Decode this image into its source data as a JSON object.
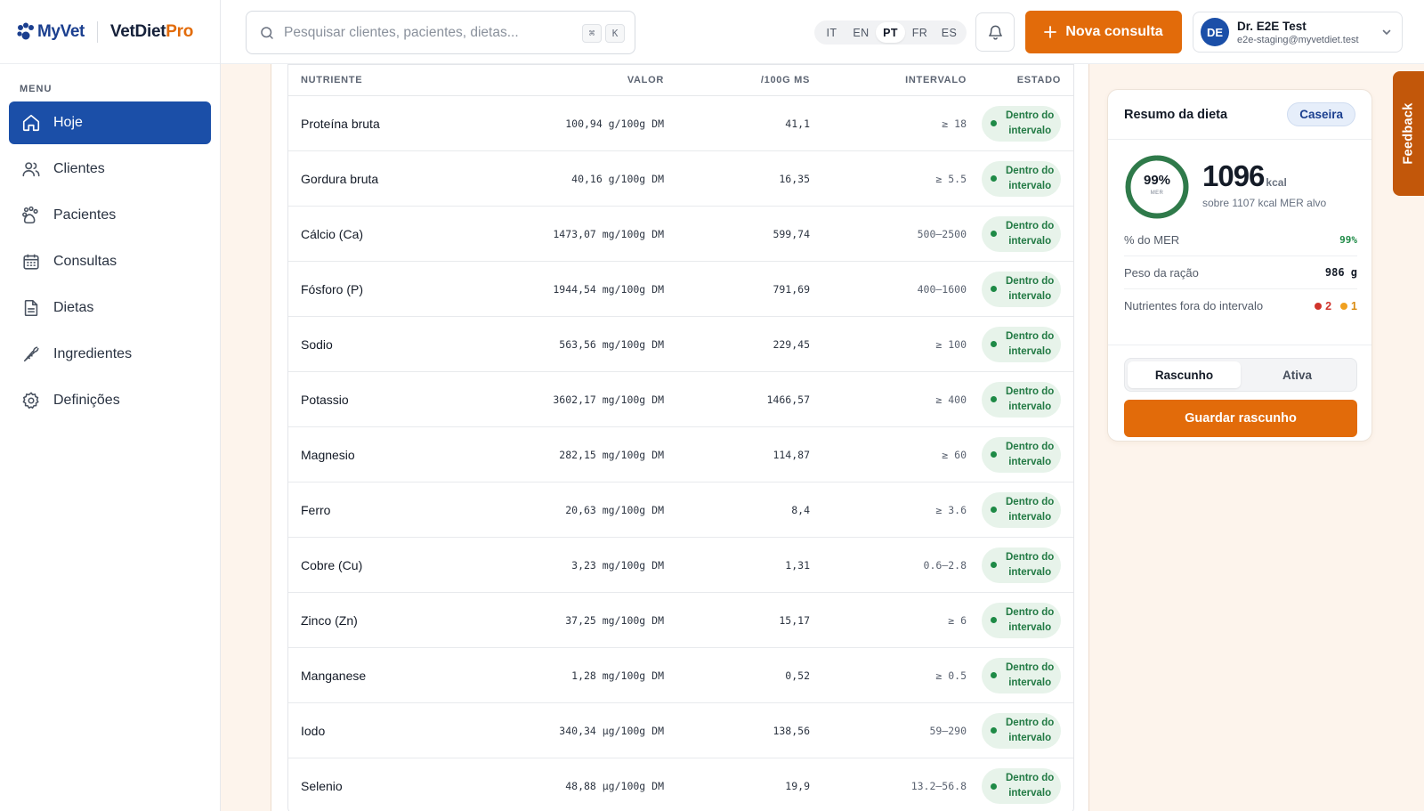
{
  "brand": {
    "myvet": "MyVet",
    "vetdiet": "VetDiet",
    "pro": "Pro"
  },
  "sidebar": {
    "menu_title": "MENU",
    "items": [
      {
        "label": "Hoje",
        "icon": "home-icon",
        "active": true
      },
      {
        "label": "Clientes",
        "icon": "users-icon"
      },
      {
        "label": "Pacientes",
        "icon": "paw-icon"
      },
      {
        "label": "Consultas",
        "icon": "calendar-icon"
      },
      {
        "label": "Dietas",
        "icon": "document-icon"
      },
      {
        "label": "Ingredientes",
        "icon": "carrot-icon"
      },
      {
        "label": "Definições",
        "icon": "gear-icon"
      }
    ]
  },
  "topbar": {
    "search_placeholder": "Pesquisar clientes, pacientes, dietas...",
    "kbd_1": "⌘",
    "kbd_2": "K",
    "languages": [
      "IT",
      "EN",
      "PT",
      "FR",
      "ES"
    ],
    "active_language": "PT",
    "new_consult_label": "Nova consulta",
    "user": {
      "initials": "DE",
      "name": "Dr. E2E Test",
      "email": "e2e-staging@myvetdiet.test"
    }
  },
  "table": {
    "headers": {
      "nutrient": "NUTRIENTE",
      "value": "VALOR",
      "per100": "/100G MS",
      "interval": "INTERVALO",
      "state": "ESTADO"
    },
    "rows": [
      {
        "name": "Proteína bruta",
        "value": "100,94 g/100g DM",
        "per100": "41,1",
        "interval": "≥ 18",
        "state": [
          "Dentro do",
          "intervalo"
        ]
      },
      {
        "name": "Gordura bruta",
        "value": "40,16 g/100g DM",
        "per100": "16,35",
        "interval": "≥ 5.5",
        "state": [
          "Dentro do",
          "intervalo"
        ]
      },
      {
        "name": "Cálcio (Ca)",
        "value": "1473,07 mg/100g DM",
        "per100": "599,74",
        "interval": "500–2500",
        "state": [
          "Dentro do",
          "intervalo"
        ]
      },
      {
        "name": "Fósforo (P)",
        "value": "1944,54 mg/100g DM",
        "per100": "791,69",
        "interval": "400–1600",
        "state": [
          "Dentro do",
          "intervalo"
        ]
      },
      {
        "name": "Sodio",
        "value": "563,56 mg/100g DM",
        "per100": "229,45",
        "interval": "≥ 100",
        "state": [
          "Dentro do",
          "intervalo"
        ]
      },
      {
        "name": "Potassio",
        "value": "3602,17 mg/100g DM",
        "per100": "1466,57",
        "interval": "≥ 400",
        "state": [
          "Dentro do",
          "intervalo"
        ]
      },
      {
        "name": "Magnesio",
        "value": "282,15 mg/100g DM",
        "per100": "114,87",
        "interval": "≥ 60",
        "state": [
          "Dentro do",
          "intervalo"
        ]
      },
      {
        "name": "Ferro",
        "value": "20,63 mg/100g DM",
        "per100": "8,4",
        "interval": "≥ 3.6",
        "state": [
          "Dentro do",
          "intervalo"
        ]
      },
      {
        "name": "Cobre (Cu)",
        "value": "3,23 mg/100g DM",
        "per100": "1,31",
        "interval": "0.6–2.8",
        "state": [
          "Dentro do",
          "intervalo"
        ]
      },
      {
        "name": "Zinco (Zn)",
        "value": "37,25 mg/100g DM",
        "per100": "15,17",
        "interval": "≥ 6",
        "state": [
          "Dentro do",
          "intervalo"
        ]
      },
      {
        "name": "Manganese",
        "value": "1,28 mg/100g DM",
        "per100": "0,52",
        "interval": "≥ 0.5",
        "state": [
          "Dentro do",
          "intervalo"
        ]
      },
      {
        "name": "Iodo",
        "value": "340,34 µg/100g DM",
        "per100": "138,56",
        "interval": "59–290",
        "state": [
          "Dentro do",
          "intervalo"
        ]
      },
      {
        "name": "Selenio",
        "value": "48,88 µg/100g DM",
        "per100": "19,9",
        "interval": "13.2–56.8",
        "state": [
          "Dentro do",
          "intervalo"
        ]
      }
    ]
  },
  "summary": {
    "title": "Resumo da dieta",
    "tag": "Caseira",
    "ring_pct": "99%",
    "ring_label": "MER",
    "ring_fraction": 0.99,
    "kcal": "1096",
    "kcal_unit": "kcal",
    "kcal_sub": "sobre 1107 kcal MER alvo",
    "stats": {
      "mer_label": "% do MER",
      "mer_value": "99%",
      "weight_label": "Peso da ração",
      "weight_value": "986 g",
      "out_label": "Nutrientes fora do intervalo",
      "out_red": "2",
      "out_orange": "1"
    },
    "segments": [
      "Rascunho",
      "Ativa"
    ],
    "active_segment": "Rascunho",
    "save_label": "Guardar rascunho"
  },
  "feedback_label": "Feedback",
  "colors": {
    "primary_blue": "#1b4fa8",
    "accent_orange": "#e26b0a",
    "success_green": "#1e8a46",
    "danger_red": "#d0342c",
    "warning_orange": "#f0a020"
  }
}
